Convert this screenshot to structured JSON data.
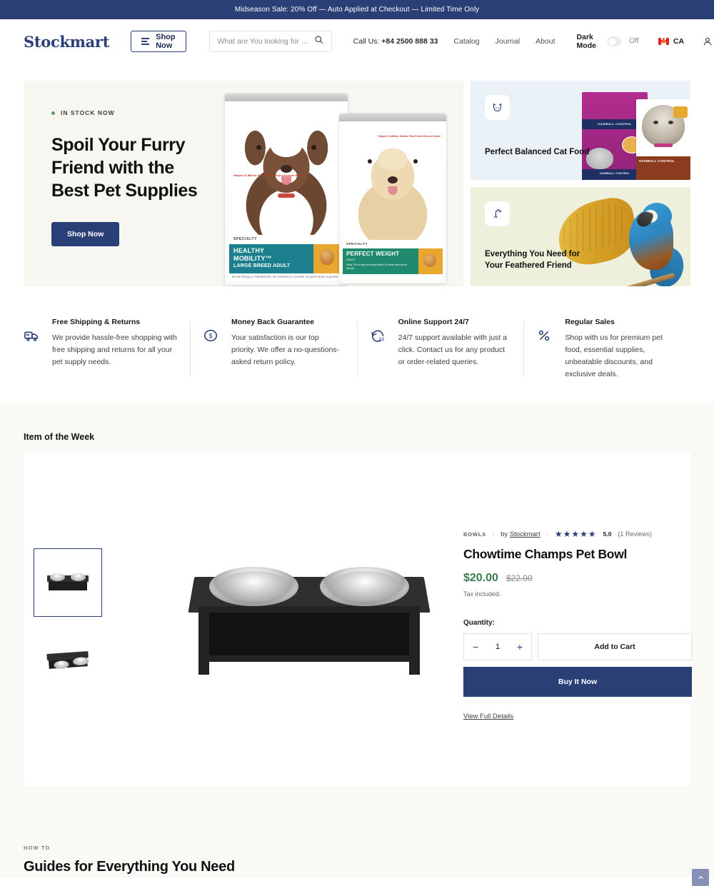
{
  "announcement": {
    "text": "Midseason Sale: 20% Off — Auto Applied at Checkout — Limited Time Only"
  },
  "header": {
    "logo": "Stockmart",
    "shop_now_label": "Shop Now",
    "search": {
      "placeholder": "What are You looking for ...",
      "value": ""
    },
    "call_us_label": "Call Us:",
    "phone": "+84 2500 888 33",
    "nav": [
      {
        "label": "Catalog"
      },
      {
        "label": "Journal"
      },
      {
        "label": "About"
      }
    ],
    "dark_mode": {
      "label": "Dark Mode",
      "state": "Off"
    },
    "locale": {
      "country_code": "CA",
      "flag": "canada-flag"
    },
    "icons": {
      "account": "user-icon",
      "cart": "cart-icon",
      "search": "search-icon",
      "menu": "hamburger-icon"
    }
  },
  "hero": {
    "badge": "IN STOCK NOW",
    "title": "Spoil Your Furry Friend with the Best Pet Supplies",
    "cta": "Shop Now",
    "product_bags": {
      "bag1": {
        "specialty": "SPECIALTY",
        "line1": "HEALTHY",
        "line2": "MOBILITY™",
        "line3": "LARGE BREED ADULT",
        "promo": "Helped 11 Million Shelter Pets Find a Forever Home",
        "footer": "NO ARTIFICIALLY PRESERVED. NO SYNTHETIC COLORS. NO ARTIFICIAL FLAVORS."
      },
      "bag2": {
        "specialty": "SPECIALTY",
        "line1": "PERFECT WEIGHT",
        "line2": "ADULT",
        "line3": "Helps 70% of dogs lose weight within 10 weeks when fed as directed",
        "promo": "Helped 11 Million Shelter Pets Find a Forever Home"
      }
    },
    "cards": [
      {
        "icon": "cat-icon",
        "title": "Perfect Balanced Cat Food",
        "product_label_1": "HAIRBALL CONTROL",
        "product_label_2": "HAIRBALL CONTROL"
      },
      {
        "icon": "bird-icon",
        "title": "Everything You Need for Your Feathered Friend"
      }
    ]
  },
  "features": [
    {
      "icon": "truck-icon",
      "heading": "Free Shipping & Returns",
      "body": "We provide hassle-free shopping with free shipping and returns for all your pet supply needs."
    },
    {
      "icon": "money-back-icon",
      "heading": "Money Back Guarantee",
      "body": "Your satisfaction is our top priority. We offer a no-questions-asked return policy."
    },
    {
      "icon": "support-24-icon",
      "heading": "Online Support 24/7",
      "body": "24/7 support available with just a click. Contact us for any product or order-related queries."
    },
    {
      "icon": "percent-icon",
      "heading": "Regular Sales",
      "body": "Shop with us for premium pet food, essential supplies, unbeatable discounts, and exclusive deals."
    }
  ],
  "item_of_week": {
    "section_title": "Item of the Week",
    "category": "BOWLS",
    "vendor_prefix": "by",
    "vendor": "Stockmart",
    "stars": "★★★★★",
    "rating": "5.0",
    "reviews": "(1 Reviews)",
    "product_title": "Chowtime Champs Pet Bowl",
    "price": "$20.00",
    "price_compare": "$22.00",
    "tax_note": "Tax included.",
    "quantity_label": "Quantity:",
    "quantity_value": "1",
    "decrease_label": "−",
    "increase_label": "+",
    "add_to_cart": "Add to Cart",
    "buy_it_now": "Buy It Now",
    "view_full_details": "View Full Details",
    "thumbnails": [
      {
        "name": "pet-bowl-front"
      },
      {
        "name": "pet-bowl-disassembled"
      }
    ]
  },
  "how_to": {
    "kicker": "HOW TO",
    "heading": "Guides for Everything You Need"
  },
  "scroll_top": {
    "icon": "chevron-up-icon"
  },
  "colors": {
    "brand_navy": "#2b3f77",
    "hero_cream": "#f7f6f0",
    "cat_card": "#eaf2f8",
    "bird_card": "#eef0dc",
    "section_bg": "#faf9f5",
    "price_green": "#3d7a4e",
    "stock_green": "#5b9e63"
  }
}
